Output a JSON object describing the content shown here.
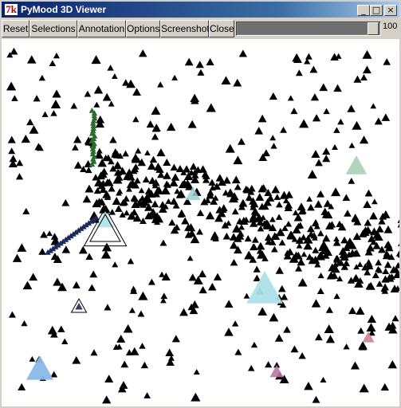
{
  "window": {
    "title": "PyMood 3D Viewer",
    "app_icon_text": "7k",
    "controls": {
      "minimize": "_",
      "maximize": "□",
      "close": "×"
    }
  },
  "toolbar": {
    "buttons": [
      "Reset",
      "Selections",
      "Annotation",
      "Options",
      "Screenshot",
      "Close"
    ],
    "slider_value": "100",
    "slider_fraction": 1.0
  },
  "viewport": {
    "background": "#ffffff",
    "description_colors": {
      "teal": "#1f6f78",
      "green": "#2e8b2e",
      "olive": "#8a8a1e",
      "red": "#b01818",
      "mauve": "#8a4a6a",
      "cyan": "#aee0e8",
      "pink": "#c06080",
      "purple": "#5a3a8a"
    }
  }
}
